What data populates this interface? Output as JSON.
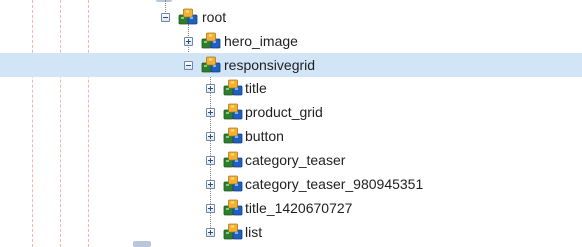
{
  "tree": {
    "root": {
      "label": "root",
      "expanded": true
    },
    "children": [
      {
        "label": "hero_image",
        "expanded": false
      },
      {
        "label": "responsivegrid",
        "expanded": true,
        "selected": true
      }
    ],
    "grandchildren": [
      {
        "label": "title"
      },
      {
        "label": "product_grid"
      },
      {
        "label": "button"
      },
      {
        "label": "category_teaser"
      },
      {
        "label": "category_teaser_980945351"
      },
      {
        "label": "title_1420670727"
      },
      {
        "label": "list"
      }
    ]
  },
  "icons": {
    "node": "component-node-icon"
  },
  "colors": {
    "selection": "#d2e5f7",
    "guide": "#f0b4b4"
  }
}
